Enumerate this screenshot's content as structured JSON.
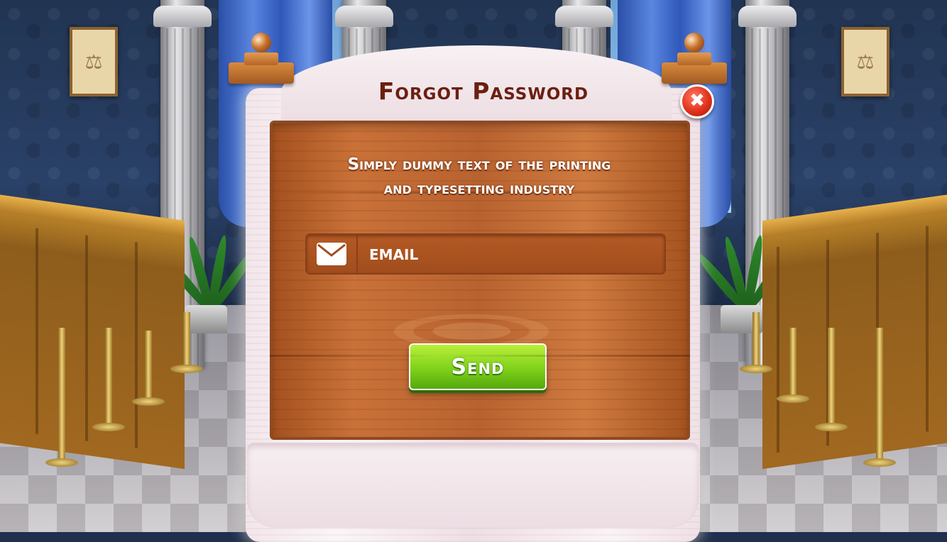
{
  "dialog": {
    "title": "Forgot Password",
    "close_symbol": "✖",
    "message_line1": "Simply dummy text of the printing",
    "message_line2": "and typesetting industry",
    "email": {
      "placeholder": "EMAIL",
      "value": "",
      "icon": "envelope-icon"
    },
    "send_label": "Send"
  },
  "colors": {
    "title": "#6b1f10",
    "close_button": "#e2321c",
    "send_button": "#7fd11a",
    "board_wood": "#c97138",
    "frame": "#f7eff2"
  },
  "background": {
    "scene": "courtroom",
    "frame_icons": [
      "scales-icon",
      "scales-icon"
    ]
  }
}
